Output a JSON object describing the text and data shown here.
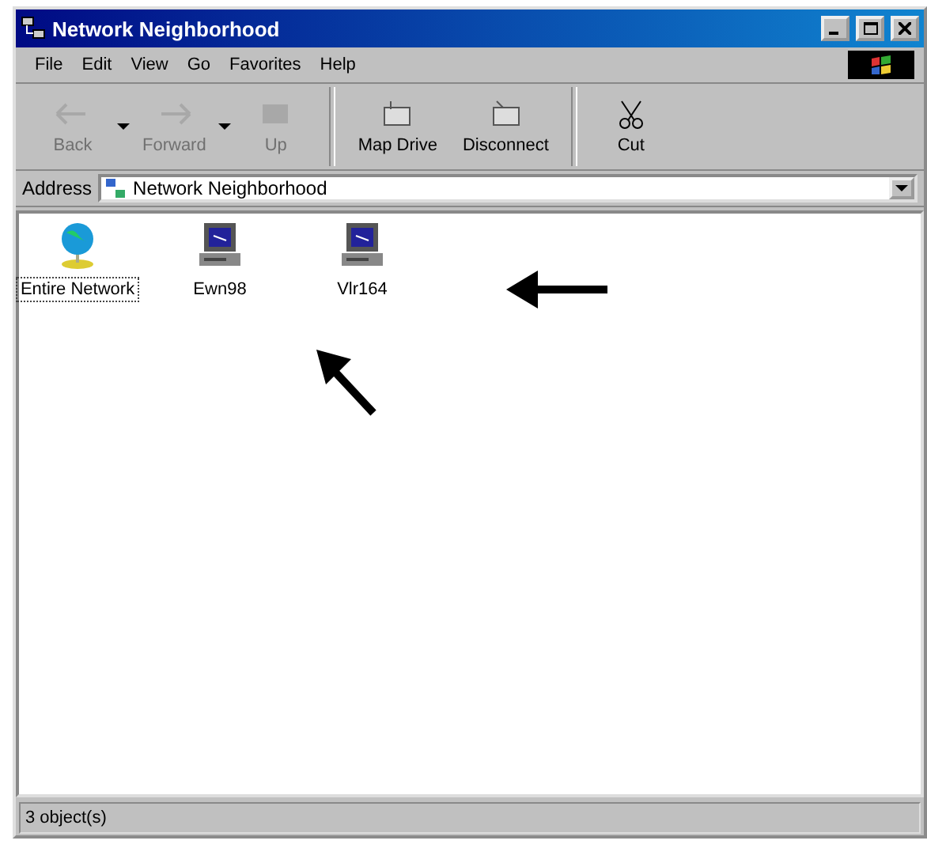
{
  "window": {
    "title": "Network Neighborhood"
  },
  "menu": [
    {
      "label": "File"
    },
    {
      "label": "Edit"
    },
    {
      "label": "View"
    },
    {
      "label": "Go"
    },
    {
      "label": "Favorites"
    },
    {
      "label": "Help"
    }
  ],
  "toolbar": [
    {
      "label": "Back",
      "kind": "back",
      "disabled": true,
      "dropdown": true
    },
    {
      "label": "Forward",
      "kind": "forward",
      "disabled": true,
      "dropdown": true
    },
    {
      "label": "Up",
      "kind": "up",
      "disabled": true,
      "dropdown": false
    },
    {
      "label": "Map Drive",
      "kind": "map",
      "disabled": false,
      "dropdown": false
    },
    {
      "label": "Disconnect",
      "kind": "disconnect",
      "disabled": false,
      "dropdown": false
    },
    {
      "label": "Cut",
      "kind": "cut",
      "disabled": false,
      "dropdown": false
    }
  ],
  "address": {
    "label": "Address",
    "value": "Network Neighborhood"
  },
  "items": [
    {
      "label": "Entire Network",
      "kind": "globe",
      "selected": true
    },
    {
      "label": "Ewn98",
      "kind": "computer",
      "selected": false
    },
    {
      "label": "Vlr164",
      "kind": "computer",
      "selected": false
    }
  ],
  "callout_arrows": [
    {
      "kind": "left"
    },
    {
      "kind": "upleft"
    }
  ],
  "status_bar": {
    "text": "3 object(s)"
  }
}
